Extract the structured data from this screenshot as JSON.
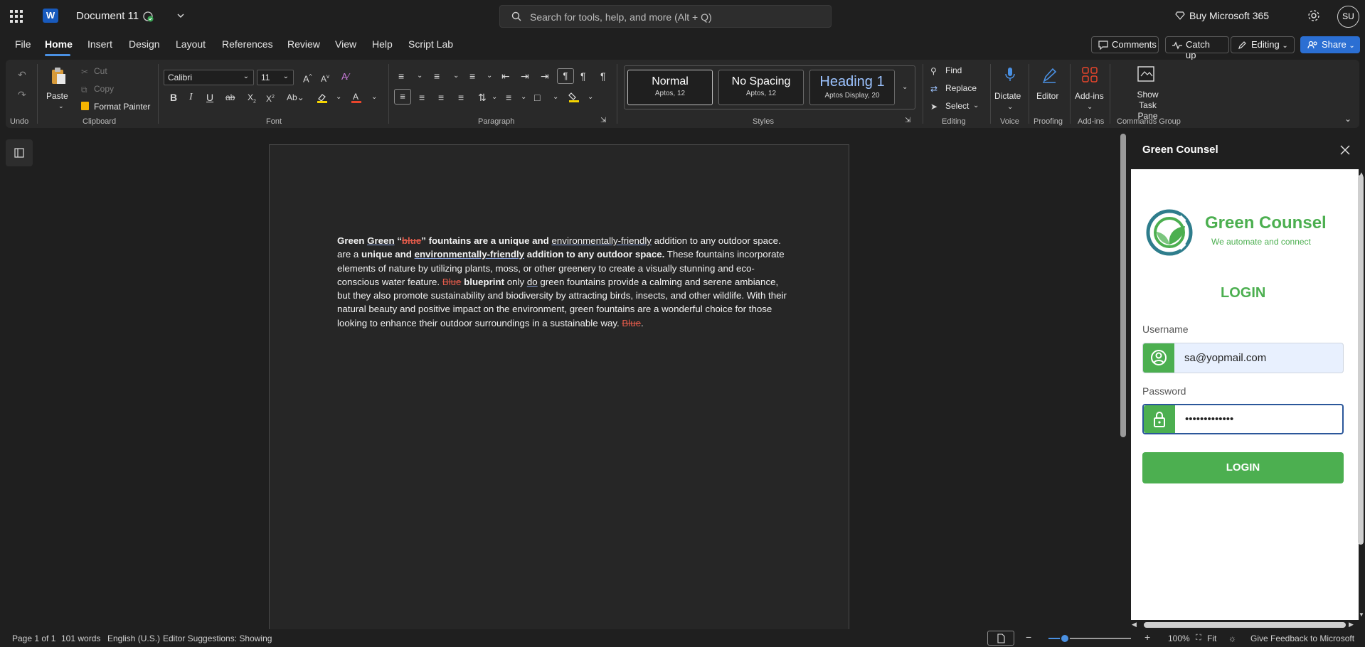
{
  "titlebar": {
    "doc_title": "Document 11",
    "search_placeholder": "Search for tools, help, and more (Alt + Q)",
    "buy": "Buy Microsoft 365",
    "avatar": "SU"
  },
  "menu": {
    "tabs": [
      "File",
      "Home",
      "Insert",
      "Design",
      "Layout",
      "References",
      "Review",
      "View",
      "Help",
      "Script Lab"
    ],
    "active_tab": "Home",
    "comments": "Comments",
    "catch_up": "Catch up",
    "editing": "Editing",
    "share": "Share"
  },
  "ribbon": {
    "undo_label": "Undo",
    "paste": "Paste",
    "cut": "Cut",
    "copy": "Copy",
    "format_painter": "Format Painter",
    "clipboard_label": "Clipboard",
    "font_name": "Calibri",
    "font_size": "11",
    "font_label": "Font",
    "paragraph_label": "Paragraph",
    "styles": [
      {
        "name": "Normal",
        "sub": "Aptos, 12"
      },
      {
        "name": "No Spacing",
        "sub": "Aptos, 12"
      },
      {
        "name": "Heading 1",
        "sub": "Aptos Display, 20"
      }
    ],
    "styles_label": "Styles",
    "find": "Find",
    "replace": "Replace",
    "select": "Select",
    "editing_label": "Editing",
    "dictate": "Dictate",
    "voice_label": "Voice",
    "editor": "Editor",
    "proofing_label": "Proofing",
    "addins": "Add-ins",
    "addins_label": "Add-ins",
    "show_task_pane": "Show Task Pane",
    "commands_group_label": "Commands Group",
    "colors": {
      "accent": "#4a90e2",
      "font_color": "#e8452c",
      "highlight": "#f5d400"
    }
  },
  "document": {
    "p1": "Green",
    "p2": "Green",
    "p3": " “",
    "p4": "blue",
    "p5": "” fountains are a unique and ",
    "p6": "environmentally-friendly",
    "p7": " addition to any outdoor space. are a ",
    "p8": "unique and ",
    "p9": "environmentally-friendly",
    "p10": " addition to any outdoor space.",
    "p11": " These fountains incorporate elements of nature by utilizing plants, moss, or other greenery to create a visually stunning and eco-conscious water feature. ",
    "p12": "Blue",
    "p13": "blueprint",
    "p14": " only ",
    "p15": "do",
    "p16": " green fountains provide a calming and serene ambiance, but they also promote sustainability and biodiversity by attracting birds, insects, and other wildlife. With their natural beauty and positive impact on the environment, green fountains are a wonderful choice for those looking to enhance their outdoor surroundings in a sustainable way. ",
    "p17": "Blue",
    "p18": "."
  },
  "taskpane": {
    "title": "Green Counsel",
    "brand_title": "Green Counsel",
    "brand_sub": "We automate and connect",
    "login_heading": "LOGIN",
    "username_label": "Username",
    "username_value": "sa@yopmail.com",
    "password_label": "Password",
    "password_value": "•••••••••••••",
    "login_button": "LOGIN",
    "brand_color": "#4caf50"
  },
  "status": {
    "page": "Page 1 of 1",
    "words": "101 words",
    "language": "English (U.S.)",
    "editor_suggestions": "Editor Suggestions: Showing",
    "zoom": "100%",
    "fit": "Fit",
    "feedback": "Give Feedback to Microsoft",
    "zoom_level": 1.0
  }
}
